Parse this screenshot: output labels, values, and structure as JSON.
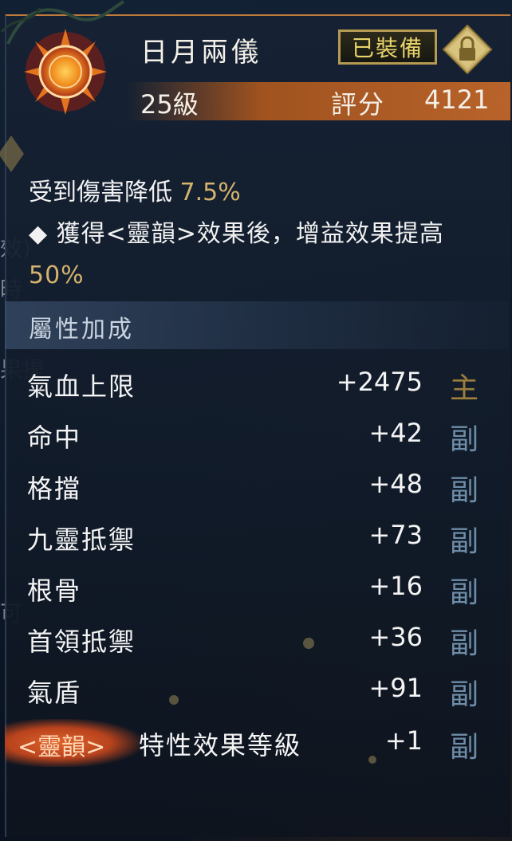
{
  "item": {
    "name": "日月兩儀",
    "level": "25級",
    "score_label": "評分",
    "score_value": "4121",
    "equipped_label": "已裝備"
  },
  "effects": {
    "line1_text": "受到傷害降低",
    "line1_value": "7.5%",
    "line2_text": "◆ 獲得<靈韻>效果後，增益效果提高",
    "line2_value": "50%"
  },
  "attributes": {
    "section_title": "屬性加成",
    "rows": [
      {
        "name": "氣血上限",
        "value": "+2475",
        "tag": "主"
      },
      {
        "name": "命中",
        "value": "+42",
        "tag": "副"
      },
      {
        "name": "格擋",
        "value": "+48",
        "tag": "副"
      },
      {
        "name": "九靈抵禦",
        "value": "+73",
        "tag": "副"
      },
      {
        "name": "根骨",
        "value": "+16",
        "tag": "副"
      },
      {
        "name": "首領抵禦",
        "value": "+36",
        "tag": "副"
      },
      {
        "name": "氣盾",
        "value": "+91",
        "tag": "副"
      },
      {
        "name": "特性效果等級",
        "value": "+1",
        "tag": "副"
      }
    ],
    "ling_badge": "<靈韻>"
  },
  "side_fragments": [
    "效)",
    "時",
    "果提",
    "可"
  ],
  "colors": {
    "accent_gold": "#d5b36f",
    "header_orange": "#b8632a",
    "tag_main": "#9d7e3c",
    "tag_sub": "#6e8da8"
  },
  "icons": [
    "sun-emblem-icon",
    "lock-icon"
  ]
}
